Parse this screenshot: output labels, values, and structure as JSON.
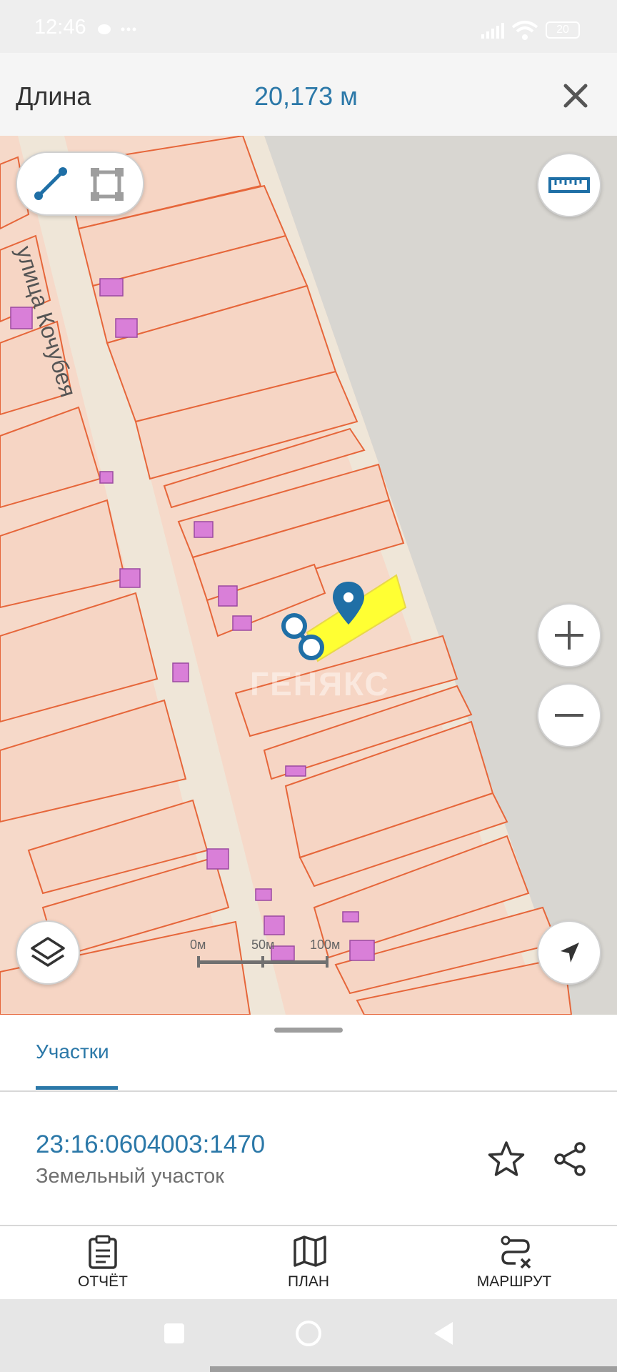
{
  "status_bar": {
    "time": "12:46",
    "battery": "20"
  },
  "measure": {
    "label": "Длина",
    "value": "20,173 м"
  },
  "map": {
    "street_label": "улица Кочубея",
    "watermark": "ГЕНЯКС",
    "scale": {
      "tick0": "0м",
      "tick1": "50м",
      "tick2": "100м"
    }
  },
  "sheet": {
    "tab_label": "Участки",
    "parcel_number": "23:16:0604003:1470",
    "parcel_type": "Земельный участок"
  },
  "bottom_nav": [
    {
      "label": "ОТЧЁТ",
      "icon": "clipboard-icon"
    },
    {
      "label": "ПЛАН",
      "icon": "map-icon"
    },
    {
      "label": "МАРШРУТ",
      "icon": "route-icon"
    }
  ],
  "colors": {
    "accent": "#2b78a8",
    "parcel_fill": "#f6d9c9",
    "parcel_border": "#e6663a",
    "building": "#d97fd8",
    "highlight": "#ffff33",
    "road": "#efe6d8"
  }
}
